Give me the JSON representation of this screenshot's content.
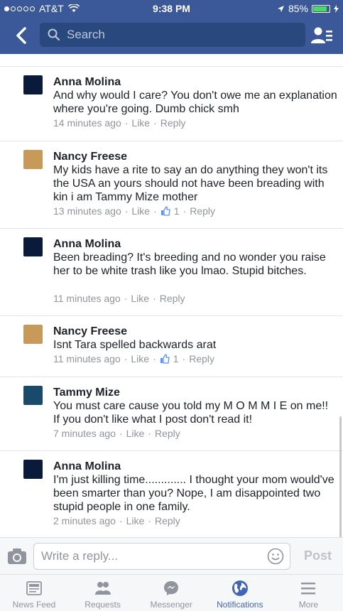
{
  "status": {
    "carrier": "AT&T",
    "time": "9:38 PM",
    "battery": "85%",
    "signal_bars": 1,
    "battery_level": 0.85
  },
  "nav": {
    "search_placeholder": "Search"
  },
  "comments": [
    {
      "name": "Anna Molina",
      "avatar": "anna",
      "text": "And why would I care? You don't owe me an explanation where you're going. Dumb chick smh",
      "time": "14 minutes ago",
      "like": "Like",
      "reply": "Reply",
      "likes": null
    },
    {
      "name": "Nancy Freese",
      "avatar": "nancy",
      "text": "My kids have a rite to say an do anything they won't its the USA an yours should not have been breading with kin i am Tammy Mize mother",
      "time": "13 minutes ago",
      "like": "Like",
      "reply": "Reply",
      "likes": "1"
    },
    {
      "name": "Anna Molina",
      "avatar": "anna",
      "text": "Been breading? It's breeding and no wonder you raise her to be white trash like you lmao. Stupid bitches.",
      "time": "11 minutes ago",
      "like": "Like",
      "reply": "Reply",
      "likes": null
    },
    {
      "name": "Nancy Freese",
      "avatar": "nancy",
      "text": "Isnt Tara spelled backwards arat",
      "time": "11 minutes ago",
      "like": "Like",
      "reply": "Reply",
      "likes": "1"
    },
    {
      "name": "Tammy Mize",
      "avatar": "tammy",
      "text": "You must care cause you told my M O M M I E on me!! If you don't like what I post don't read it!",
      "time": "7 minutes ago",
      "like": "Like",
      "reply": "Reply",
      "likes": null
    },
    {
      "name": "Anna Molina",
      "avatar": "anna",
      "text": "I'm just killing time............. I thought your mom would've been smarter than you? Nope, I am disappointed two stupid people in one family.",
      "time": "2 minutes ago",
      "like": "Like",
      "reply": "Reply",
      "likes": null
    }
  ],
  "composer": {
    "placeholder": "Write a reply...",
    "post_label": "Post"
  },
  "tabs": [
    {
      "label": "News Feed",
      "icon": "news-feed-icon",
      "active": false
    },
    {
      "label": "Requests",
      "icon": "friend-requests-icon",
      "active": false
    },
    {
      "label": "Messenger",
      "icon": "messenger-icon",
      "active": false
    },
    {
      "label": "Notifications",
      "icon": "globe-icon",
      "active": true
    },
    {
      "label": "More",
      "icon": "menu-icon",
      "active": false
    }
  ],
  "colors": {
    "brand": "#3b5998",
    "active_tab": "#4267b2",
    "meta": "#90949c",
    "battery": "#4cd964"
  }
}
